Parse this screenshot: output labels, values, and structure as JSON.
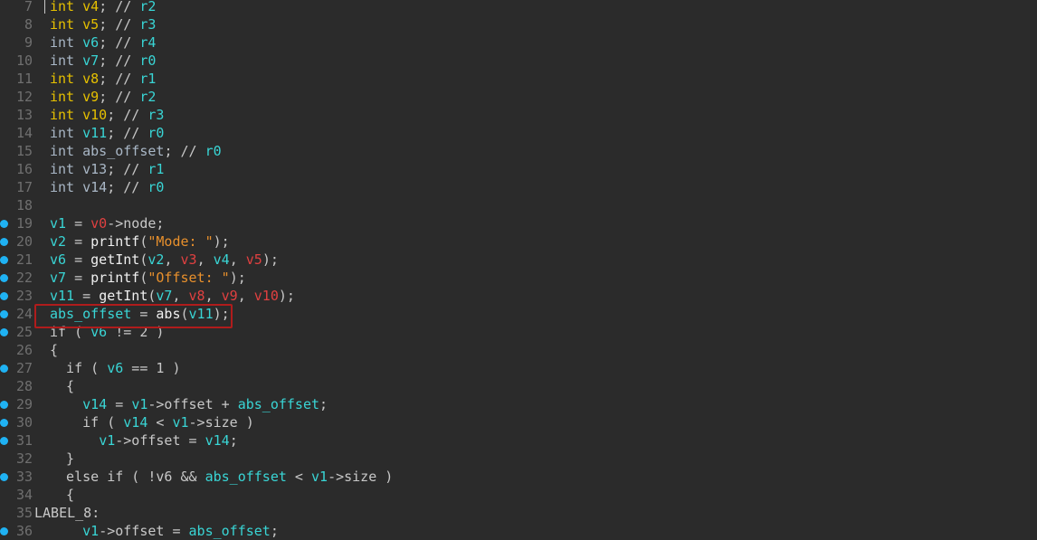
{
  "editor": {
    "lines": [
      {
        "num": "7",
        "bp": false,
        "tokens": [
          [
            "int",
            "type"
          ],
          [
            " ",
            "plain"
          ],
          [
            "v4",
            "type"
          ],
          [
            "; // ",
            "cmt"
          ],
          [
            "r2",
            "reg"
          ]
        ]
      },
      {
        "num": "8",
        "bp": false,
        "tokens": [
          [
            "int",
            "type"
          ],
          [
            " ",
            "plain"
          ],
          [
            "v5",
            "type"
          ],
          [
            "; // ",
            "cmt"
          ],
          [
            "r3",
            "reg"
          ]
        ]
      },
      {
        "num": "9",
        "bp": false,
        "tokens": [
          [
            "int",
            "type-dim"
          ],
          [
            " ",
            "plain"
          ],
          [
            "v6",
            "var"
          ],
          [
            "; // ",
            "cmt"
          ],
          [
            "r4",
            "reg"
          ]
        ]
      },
      {
        "num": "10",
        "bp": false,
        "tokens": [
          [
            "int",
            "type-dim"
          ],
          [
            " ",
            "plain"
          ],
          [
            "v7",
            "var"
          ],
          [
            "; // ",
            "cmt"
          ],
          [
            "r0",
            "reg"
          ]
        ]
      },
      {
        "num": "11",
        "bp": false,
        "tokens": [
          [
            "int",
            "type"
          ],
          [
            " ",
            "plain"
          ],
          [
            "v8",
            "type"
          ],
          [
            "; // ",
            "cmt"
          ],
          [
            "r1",
            "reg"
          ]
        ]
      },
      {
        "num": "12",
        "bp": false,
        "tokens": [
          [
            "int",
            "type"
          ],
          [
            " ",
            "plain"
          ],
          [
            "v9",
            "type"
          ],
          [
            "; // ",
            "cmt"
          ],
          [
            "r2",
            "reg"
          ]
        ]
      },
      {
        "num": "13",
        "bp": false,
        "tokens": [
          [
            "int",
            "type"
          ],
          [
            " ",
            "plain"
          ],
          [
            "v10",
            "type"
          ],
          [
            "; // ",
            "cmt"
          ],
          [
            "r3",
            "reg"
          ]
        ]
      },
      {
        "num": "14",
        "bp": false,
        "tokens": [
          [
            "int",
            "type-dim"
          ],
          [
            " ",
            "plain"
          ],
          [
            "v11",
            "var"
          ],
          [
            "; // ",
            "cmt"
          ],
          [
            "r0",
            "reg"
          ]
        ]
      },
      {
        "num": "15",
        "bp": false,
        "tokens": [
          [
            "int",
            "type-dim"
          ],
          [
            " ",
            "plain"
          ],
          [
            "abs_offset",
            "type-dim"
          ],
          [
            "; // ",
            "cmt"
          ],
          [
            "r0",
            "reg"
          ]
        ]
      },
      {
        "num": "16",
        "bp": false,
        "tokens": [
          [
            "int",
            "type-dim"
          ],
          [
            " ",
            "plain"
          ],
          [
            "v13",
            "type-dim"
          ],
          [
            "; // ",
            "cmt"
          ],
          [
            "r1",
            "reg"
          ]
        ]
      },
      {
        "num": "17",
        "bp": false,
        "tokens": [
          [
            "int",
            "type-dim"
          ],
          [
            " ",
            "plain"
          ],
          [
            "v14",
            "type-dim"
          ],
          [
            "; // ",
            "cmt"
          ],
          [
            "r0",
            "reg"
          ]
        ]
      },
      {
        "num": "18",
        "bp": false,
        "tokens": []
      },
      {
        "num": "19",
        "bp": true,
        "tokens": [
          [
            "v1",
            "var"
          ],
          [
            " = ",
            "plain"
          ],
          [
            "v0",
            "arg"
          ],
          [
            "->node;",
            "plain"
          ]
        ]
      },
      {
        "num": "20",
        "bp": true,
        "tokens": [
          [
            "v2",
            "var"
          ],
          [
            " = ",
            "plain"
          ],
          [
            "printf",
            "fn"
          ],
          [
            "(",
            "plain"
          ],
          [
            "\"Mode: \"",
            "str"
          ],
          [
            ");",
            "plain"
          ]
        ]
      },
      {
        "num": "21",
        "bp": true,
        "tokens": [
          [
            "v6",
            "var"
          ],
          [
            " = ",
            "plain"
          ],
          [
            "getInt",
            "fn"
          ],
          [
            "(",
            "plain"
          ],
          [
            "v2",
            "var"
          ],
          [
            ", ",
            "plain"
          ],
          [
            "v3",
            "arg"
          ],
          [
            ", ",
            "plain"
          ],
          [
            "v4",
            "var"
          ],
          [
            ", ",
            "plain"
          ],
          [
            "v5",
            "arg"
          ],
          [
            ");",
            "plain"
          ]
        ]
      },
      {
        "num": "22",
        "bp": true,
        "tokens": [
          [
            "v7",
            "var"
          ],
          [
            " = ",
            "plain"
          ],
          [
            "printf",
            "fn"
          ],
          [
            "(",
            "plain"
          ],
          [
            "\"Offset: \"",
            "str"
          ],
          [
            ");",
            "plain"
          ]
        ]
      },
      {
        "num": "23",
        "bp": true,
        "tokens": [
          [
            "v11",
            "var"
          ],
          [
            " = ",
            "plain"
          ],
          [
            "getInt",
            "fn"
          ],
          [
            "(",
            "plain"
          ],
          [
            "v7",
            "var"
          ],
          [
            ", ",
            "plain"
          ],
          [
            "v8",
            "arg"
          ],
          [
            ", ",
            "plain"
          ],
          [
            "v9",
            "arg"
          ],
          [
            ", ",
            "plain"
          ],
          [
            "v10",
            "arg"
          ],
          [
            ");",
            "plain"
          ]
        ]
      },
      {
        "num": "24",
        "bp": true,
        "tokens": [
          [
            "abs_offset",
            "var"
          ],
          [
            " = ",
            "plain"
          ],
          [
            "abs",
            "fn"
          ],
          [
            "(",
            "plain"
          ],
          [
            "v11",
            "var"
          ],
          [
            ");",
            "plain"
          ]
        ]
      },
      {
        "num": "25",
        "bp": true,
        "tokens": [
          [
            "if ( ",
            "plain"
          ],
          [
            "v6",
            "var"
          ],
          [
            " != 2 )",
            "plain"
          ]
        ]
      },
      {
        "num": "26",
        "bp": false,
        "tokens": [
          [
            "{",
            "plain"
          ]
        ]
      },
      {
        "num": "27",
        "bp": true,
        "tokens": [
          [
            "  if ( ",
            "plain"
          ],
          [
            "v6",
            "var"
          ],
          [
            " == 1 )",
            "plain"
          ]
        ]
      },
      {
        "num": "28",
        "bp": false,
        "tokens": [
          [
            "  {",
            "plain"
          ]
        ]
      },
      {
        "num": "29",
        "bp": true,
        "tokens": [
          [
            "    ",
            "plain"
          ],
          [
            "v14",
            "var"
          ],
          [
            " = ",
            "plain"
          ],
          [
            "v1",
            "var"
          ],
          [
            "->offset + ",
            "plain"
          ],
          [
            "abs_offset",
            "var"
          ],
          [
            ";",
            "plain"
          ]
        ]
      },
      {
        "num": "30",
        "bp": true,
        "tokens": [
          [
            "    if ( ",
            "plain"
          ],
          [
            "v14",
            "var"
          ],
          [
            " < ",
            "plain"
          ],
          [
            "v1",
            "var"
          ],
          [
            "->size )",
            "plain"
          ]
        ]
      },
      {
        "num": "31",
        "bp": true,
        "tokens": [
          [
            "      ",
            "plain"
          ],
          [
            "v1",
            "var"
          ],
          [
            "->offset = ",
            "plain"
          ],
          [
            "v14",
            "var"
          ],
          [
            ";",
            "plain"
          ]
        ]
      },
      {
        "num": "32",
        "bp": false,
        "tokens": [
          [
            "  }",
            "plain"
          ]
        ]
      },
      {
        "num": "33",
        "bp": true,
        "tokens": [
          [
            "  else if ( !v6 && ",
            "plain"
          ],
          [
            "abs_offset",
            "var"
          ],
          [
            " < ",
            "plain"
          ],
          [
            "v1",
            "var"
          ],
          [
            "->size )",
            "plain"
          ]
        ]
      },
      {
        "num": "34",
        "bp": false,
        "tokens": [
          [
            "  {",
            "plain"
          ]
        ]
      },
      {
        "num": "35",
        "bp": false,
        "label": true,
        "tokens": [
          [
            "LABEL_8:",
            "plain"
          ]
        ]
      },
      {
        "num": "36",
        "bp": true,
        "tokens": [
          [
            "    ",
            "plain"
          ],
          [
            "v1",
            "var"
          ],
          [
            "->offset = ",
            "plain"
          ],
          [
            "abs_offset",
            "var"
          ],
          [
            ";",
            "plain"
          ]
        ]
      }
    ]
  }
}
